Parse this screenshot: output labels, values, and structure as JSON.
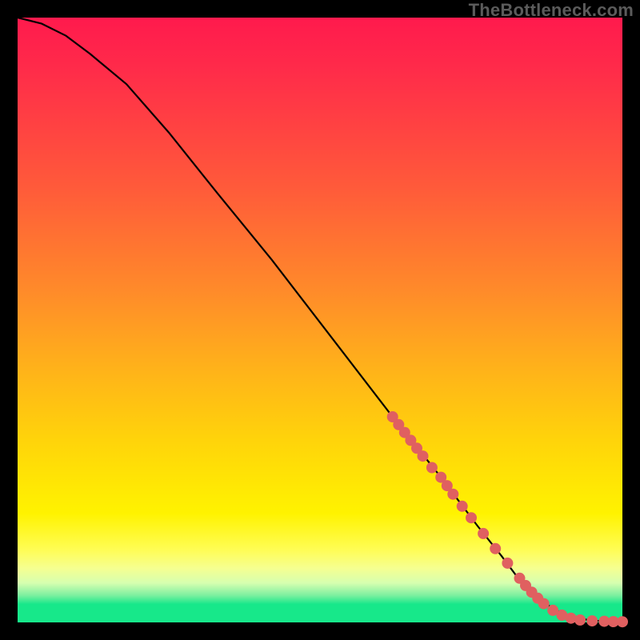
{
  "watermark": "TheBottleneck.com",
  "chart_data": {
    "type": "line",
    "title": "",
    "xlabel": "",
    "ylabel": "",
    "xlim": [
      0,
      100
    ],
    "ylim": [
      0,
      100
    ],
    "curve": {
      "name": "bottleneck-curve",
      "x": [
        0,
        4,
        8,
        12,
        18,
        25,
        33,
        42,
        52,
        62,
        70,
        76,
        80,
        83,
        86,
        89,
        92,
        95,
        98,
        100
      ],
      "y": [
        100,
        99,
        97,
        94,
        89,
        81,
        71,
        60,
        47,
        34,
        24,
        16,
        11,
        7,
        4,
        2,
        0.8,
        0.3,
        0.15,
        0.1
      ]
    },
    "markers": {
      "name": "highlighted-points",
      "color": "#e06060",
      "x": [
        62,
        63,
        64,
        65,
        66,
        67,
        68.5,
        70,
        71,
        72,
        73.5,
        75,
        77,
        79,
        81,
        83,
        84,
        85,
        86,
        87,
        88.5,
        90,
        91.5,
        93,
        95,
        97,
        98.5,
        100
      ],
      "y": [
        34,
        32.7,
        31.4,
        30.1,
        28.8,
        27.5,
        25.6,
        24,
        22.6,
        21.2,
        19.2,
        17.3,
        14.7,
        12.2,
        9.8,
        7.3,
        6.1,
        5,
        4.0,
        3.1,
        2.0,
        1.2,
        0.7,
        0.4,
        0.25,
        0.18,
        0.13,
        0.1
      ]
    }
  }
}
